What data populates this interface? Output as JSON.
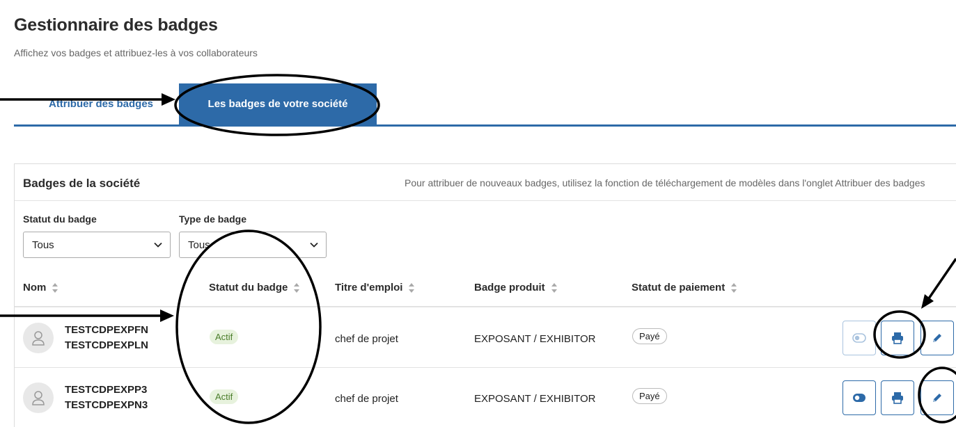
{
  "page": {
    "title": "Gestionnaire des badges",
    "subtitle": "Affichez vos badges et attribuez-les à vos collaborateurs"
  },
  "tabs": [
    {
      "label": "Attribuer des badges",
      "active": false
    },
    {
      "label": "Les badges de votre société",
      "active": true
    }
  ],
  "card": {
    "title": "Badges de la société",
    "hint": "Pour attribuer de nouveaux badges, utilisez la fonction de téléchargement de modèles dans l'onglet Attribuer des badges"
  },
  "filters": {
    "status": {
      "label": "Statut du badge",
      "value": "Tous"
    },
    "type": {
      "label": "Type de badge",
      "value": "Tous"
    }
  },
  "table": {
    "columns": [
      "Nom",
      "Statut du badge",
      "Titre d'emploi",
      "Badge produit",
      "Statut de paiement"
    ],
    "rows": [
      {
        "first_name": "TESTCDPEXPFN",
        "last_name": "TESTCDPEXPLN",
        "status": "Actif",
        "job_title": "chef de projet",
        "product": "EXPOSANT / EXHIBITOR",
        "payment": "Payé"
      },
      {
        "first_name": "TESTCDPEXPP3",
        "last_name": "TESTCDPEXPN3",
        "status": "Actif",
        "job_title": "chef de projet",
        "product": "EXPOSANT / EXHIBITOR",
        "payment": "Payé"
      }
    ]
  },
  "icons": {
    "avatar": "user-icon",
    "toggle": "toggle-icon",
    "print": "printer-icon",
    "edit": "pencil-icon",
    "sort": "sort-icon",
    "dropdown": "chevron-down-icon"
  },
  "colors": {
    "accent": "#2d6aa8",
    "status_active_bg": "#e7f2dd",
    "status_active_text": "#4a7d2a"
  }
}
